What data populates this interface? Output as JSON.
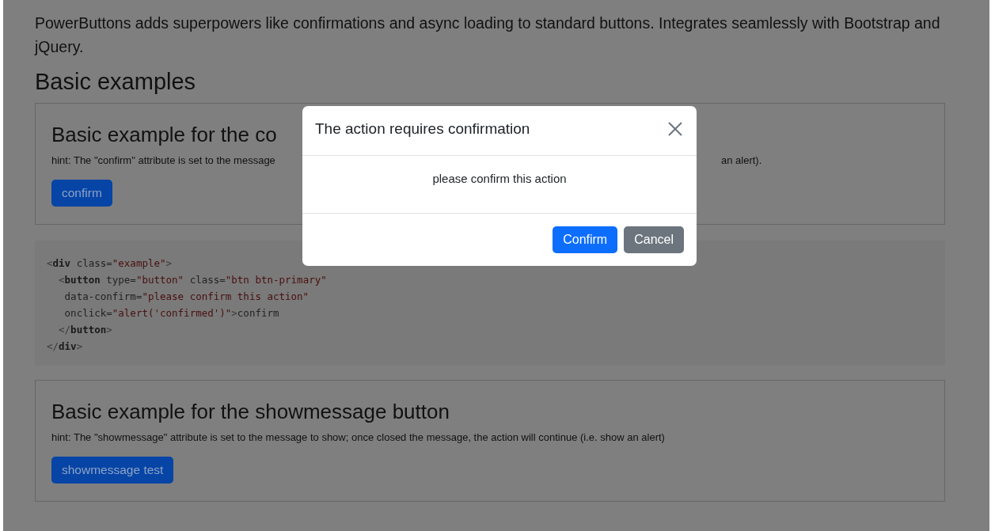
{
  "intro": "PowerButtons adds superpowers like confirmations and async loading to standard buttons. Integrates seamlessly with Bootstrap and jQuery.",
  "section_title": "Basic examples",
  "examples": [
    {
      "title": "Basic example for the co",
      "hint": "hint: The \"confirm\" attribute is set to the message",
      "hint_tail": "an alert).",
      "button": "confirm"
    },
    {
      "title": "Basic example for the showmessage button",
      "hint": "hint: The \"showmessage\" attribute is set to the message to show; once closed the message, the action will continue (i.e. show an alert)",
      "button": "showmessage test"
    }
  ],
  "code_lines": [
    [
      {
        "kind": "punct",
        "text": "<"
      },
      {
        "kind": "tag",
        "text": "div"
      },
      {
        "kind": "attr",
        "text": " class="
      },
      {
        "kind": "value",
        "text": "\"example\""
      },
      {
        "kind": "punct",
        "text": ">"
      }
    ],
    [
      {
        "kind": "punct",
        "text": "  <"
      },
      {
        "kind": "tag",
        "text": "button"
      },
      {
        "kind": "attr",
        "text": " type="
      },
      {
        "kind": "value",
        "text": "\"button\""
      },
      {
        "kind": "attr",
        "text": " class="
      },
      {
        "kind": "value",
        "text": "\"btn btn-primary\""
      }
    ],
    [
      {
        "kind": "attr",
        "text": "   data-confirm="
      },
      {
        "kind": "value",
        "text": "\"please confirm this action\""
      }
    ],
    [
      {
        "kind": "attr",
        "text": "   onclick="
      },
      {
        "kind": "value",
        "text": "\"alert('confirmed')\""
      },
      {
        "kind": "punct",
        "text": ">"
      },
      {
        "kind": "attr",
        "text": "confirm"
      }
    ],
    [
      {
        "kind": "punct",
        "text": "  </"
      },
      {
        "kind": "tag",
        "text": "button"
      },
      {
        "kind": "punct",
        "text": ">"
      }
    ],
    [
      {
        "kind": "punct",
        "text": "</"
      },
      {
        "kind": "tag",
        "text": "div"
      },
      {
        "kind": "punct",
        "text": ">"
      }
    ]
  ],
  "modal": {
    "title": "The action requires confirmation",
    "message": "please confirm this action",
    "buttons": [
      {
        "label": "Confirm",
        "kind": "primary"
      },
      {
        "label": "Cancel",
        "kind": "secondary"
      }
    ]
  }
}
